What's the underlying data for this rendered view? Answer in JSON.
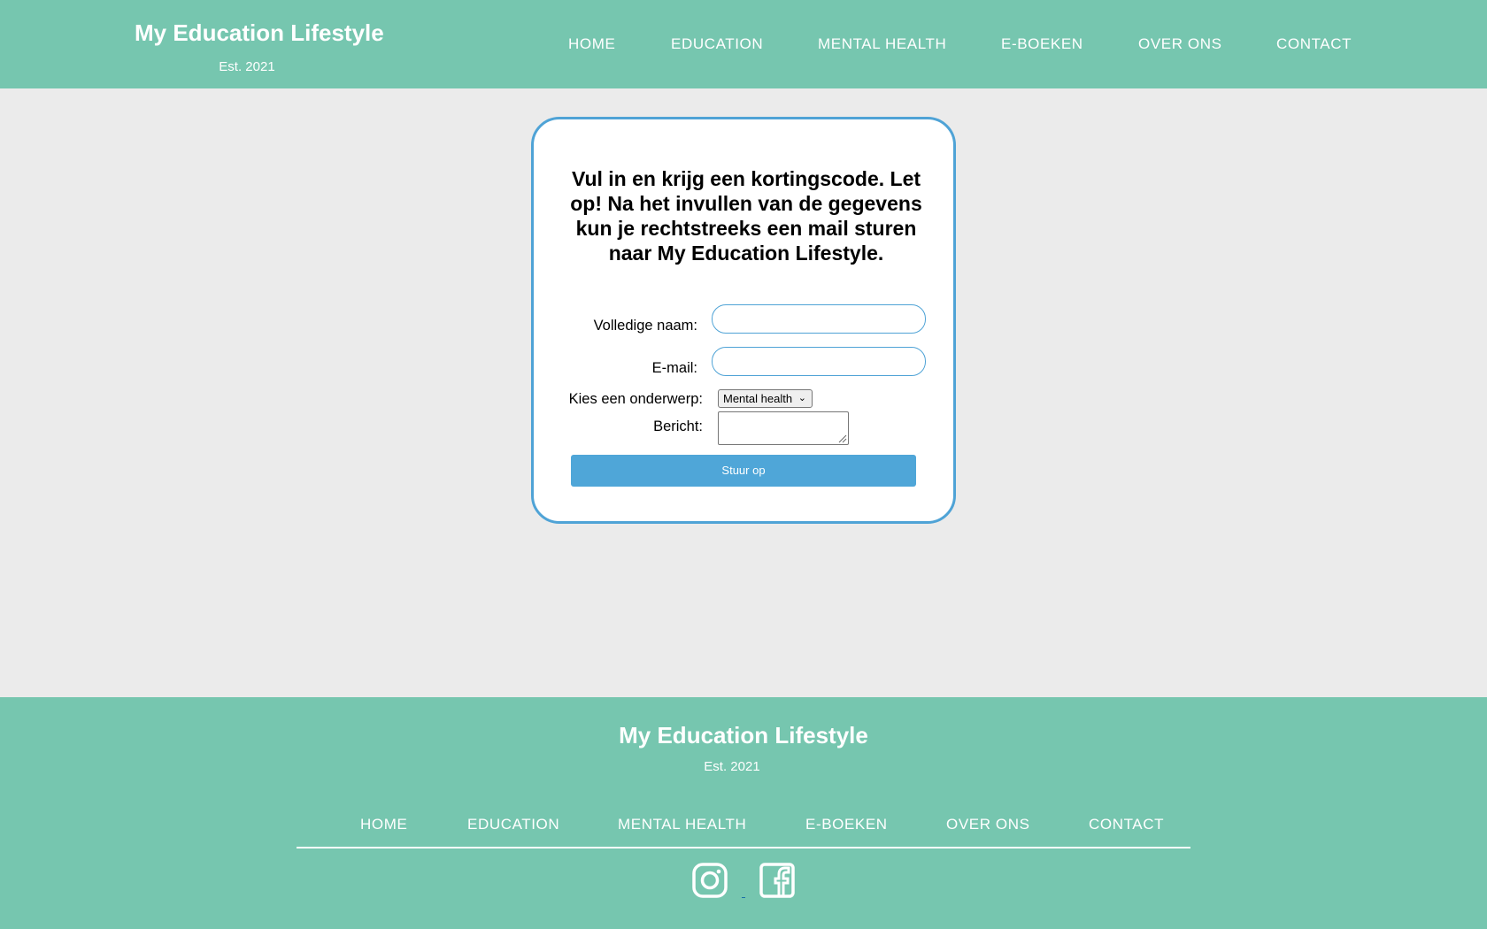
{
  "header": {
    "brand_title": "My Education Lifestyle",
    "brand_sub": "Est. 2021",
    "nav": [
      "HOME",
      "EDUCATION",
      "MENTAL HEALTH",
      "E-BOEKEN",
      "OVER ONS",
      "CONTACT"
    ]
  },
  "form": {
    "heading": "Vul in en krijg een kortingscode. Let op! Na het invullen van de gegevens kun je rechtstreeks een mail sturen naar My Education Lifestyle.",
    "name_label": "Volledige naam:",
    "name_value": "",
    "email_label": "E-mail:",
    "email_value": "",
    "subject_label": "Kies een onderwerp:",
    "subject_selected": "Mental health",
    "message_label": "Bericht:",
    "submit_label": "Stuur op"
  },
  "footer": {
    "title": "My Education Lifestyle",
    "sub": "Est. 2021",
    "nav": [
      "HOME",
      "EDUCATION",
      "MENTAL HEALTH",
      "E-BOEKEN",
      "OVER ONS",
      "CONTACT"
    ],
    "social_icons": [
      "instagram-icon",
      "facebook-icon"
    ]
  },
  "colors": {
    "brand_green": "#76c6af",
    "accent_blue": "#4fa3d6",
    "page_bg": "#ebebeb"
  }
}
